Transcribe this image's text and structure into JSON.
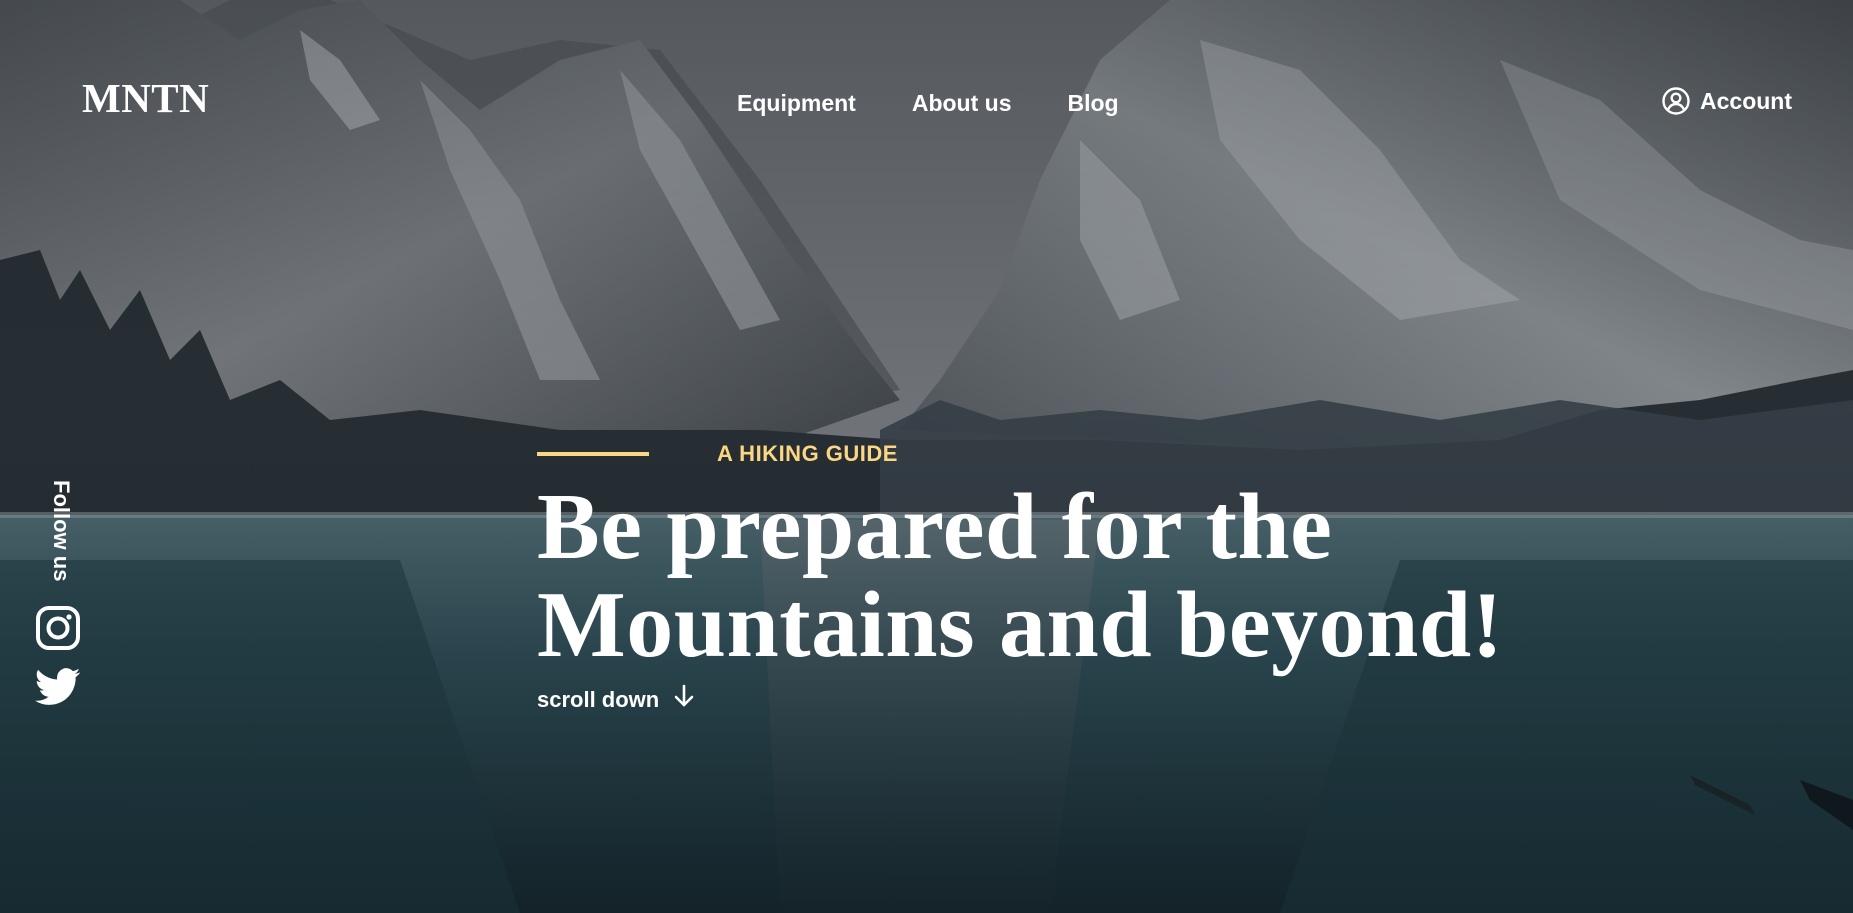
{
  "brand": {
    "logo": "MNTN"
  },
  "nav": {
    "items": [
      {
        "label": "Equipment"
      },
      {
        "label": "About us"
      },
      {
        "label": "Blog"
      }
    ],
    "account_label": "Account"
  },
  "social": {
    "follow_label": "Follow us",
    "links": [
      {
        "icon": "instagram-icon"
      },
      {
        "icon": "twitter-icon"
      }
    ]
  },
  "hero": {
    "eyebrow": "A HIKING GUIDE",
    "headline_line1": "Be prepared for the",
    "headline_line2": "Mountains and beyond!",
    "scroll_label": "scroll down"
  },
  "colors": {
    "accent": "#FBD784",
    "text": "#FFFFFF"
  }
}
